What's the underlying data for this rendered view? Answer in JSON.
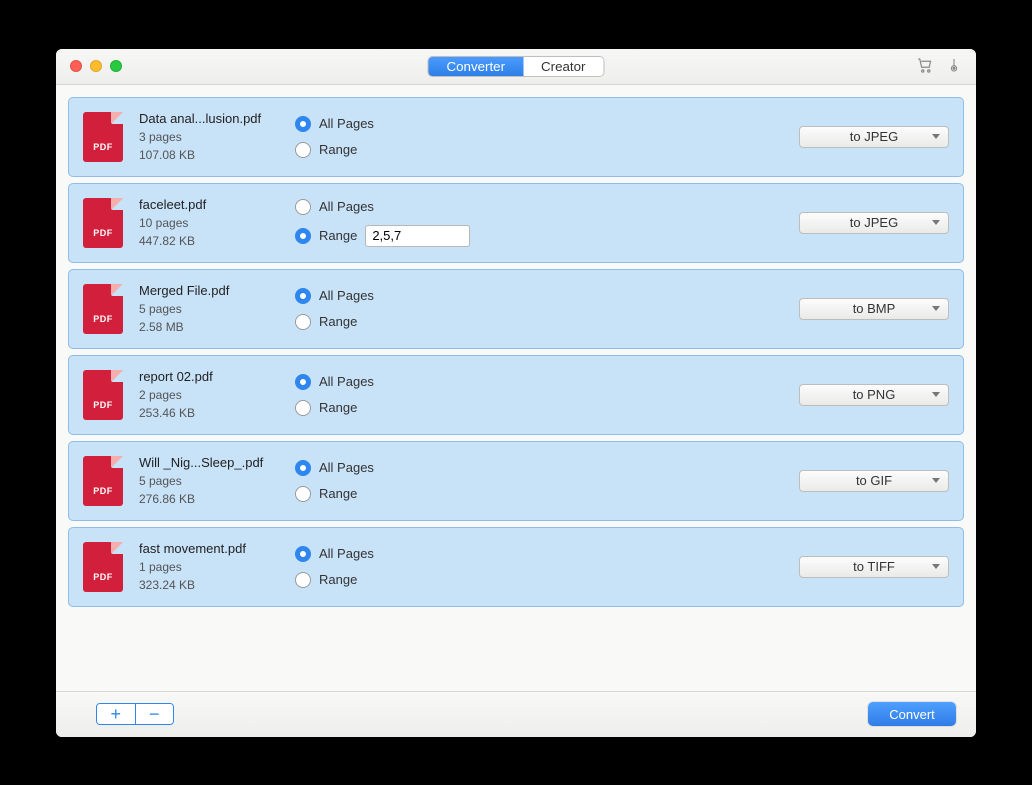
{
  "header": {
    "tabs": {
      "left": "Converter",
      "right": "Creator"
    }
  },
  "labels": {
    "all_pages": "All Pages",
    "range": "Range",
    "convert": "Convert",
    "pdf_badge": "PDF"
  },
  "files": [
    {
      "name": "Data anal...lusion.pdf",
      "pages": "3 pages",
      "size": "107.08 KB",
      "selected": "all",
      "range_value": "",
      "format": "to JPEG"
    },
    {
      "name": "faceleet.pdf",
      "pages": "10 pages",
      "size": "447.82 KB",
      "selected": "range",
      "range_value": "2,5,7",
      "format": "to JPEG"
    },
    {
      "name": "Merged File.pdf",
      "pages": "5 pages",
      "size": "2.58 MB",
      "selected": "all",
      "range_value": "",
      "format": "to BMP"
    },
    {
      "name": "report 02.pdf",
      "pages": "2 pages",
      "size": "253.46 KB",
      "selected": "all",
      "range_value": "",
      "format": "to PNG"
    },
    {
      "name": "Will _Nig...Sleep_.pdf",
      "pages": "5 pages",
      "size": "276.86 KB",
      "selected": "all",
      "range_value": "",
      "format": "to GIF"
    },
    {
      "name": "fast movement.pdf",
      "pages": "1 pages",
      "size": "323.24 KB",
      "selected": "all",
      "range_value": "",
      "format": "to TIFF"
    }
  ]
}
